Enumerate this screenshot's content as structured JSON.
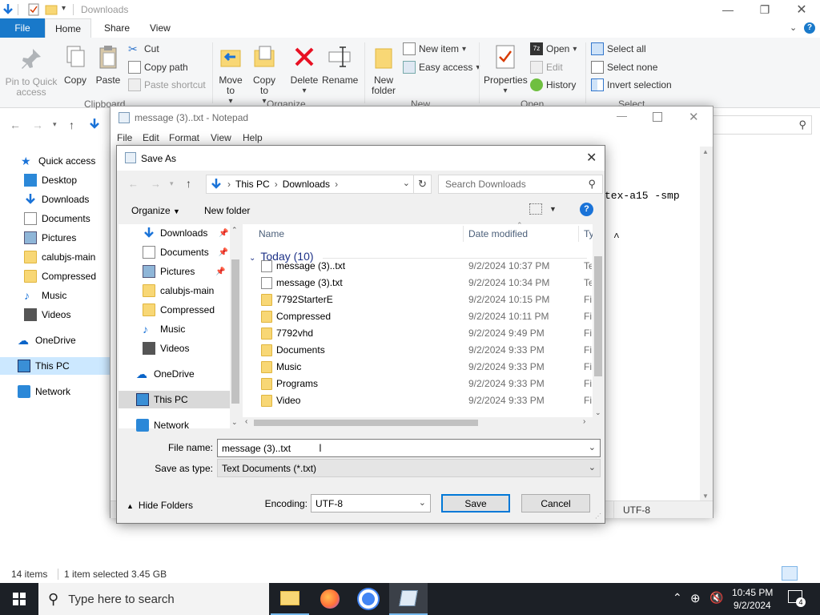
{
  "explorer": {
    "title": "Downloads",
    "tabs": [
      "File",
      "Home",
      "Share",
      "View"
    ],
    "ribbon": {
      "pin_to_quick_access": "Pin to Quick access",
      "copy": "Copy",
      "paste": "Paste",
      "cut": "Cut",
      "copy_path": "Copy path",
      "paste_shortcut": "Paste shortcut",
      "clipboard_group": "Clipboard",
      "move_to": "Move to",
      "copy_to": "Copy to",
      "delete": "Delete",
      "rename": "Rename",
      "organize_group": "Organize",
      "new_folder": "New folder",
      "new_item": "New item",
      "easy_access": "Easy access",
      "new_group": "New",
      "properties": "Properties",
      "open": "Open",
      "edit": "Edit",
      "history": "History",
      "open_group": "Open",
      "select_all": "Select all",
      "select_none": "Select none",
      "invert_selection": "Invert selection",
      "select_group": "Select"
    },
    "nav": {
      "quick_access": "Quick access",
      "desktop": "Desktop",
      "downloads": "Downloads",
      "documents": "Documents",
      "pictures": "Pictures",
      "calubjs_main": "calubjs-main",
      "compressed": "Compressed",
      "music": "Music",
      "videos": "Videos",
      "onedrive": "OneDrive",
      "this_pc": "This PC",
      "network": "Network"
    },
    "status": {
      "items": "14 items",
      "selected": "1 item selected  3.45 GB"
    }
  },
  "notepad": {
    "title": "message (3)..txt - Notepad",
    "menu": [
      "File",
      "Edit",
      "Format",
      "View",
      "Help"
    ],
    "text_line1": "tex-a15 -smp",
    "text_line2": "^",
    "status_encoding": "UTF-8"
  },
  "saveas": {
    "title": "Save As",
    "path": {
      "this_pc": "This PC",
      "downloads": "Downloads"
    },
    "search_placeholder": "Search Downloads",
    "organize": "Organize",
    "new_folder": "New folder",
    "nav": {
      "downloads": "Downloads",
      "documents": "Documents",
      "pictures": "Pictures",
      "calubjs_main": "calubjs-main",
      "compressed": "Compressed",
      "music": "Music",
      "videos": "Videos",
      "onedrive": "OneDrive",
      "this_pc": "This PC",
      "network": "Network"
    },
    "columns": {
      "name": "Name",
      "date": "Date modified",
      "type": "Ty"
    },
    "group_label": "Today (10)",
    "files": [
      {
        "name": "message (3)..txt",
        "date": "9/2/2024 10:37 PM",
        "type": "Te",
        "kind": "txt"
      },
      {
        "name": "message (3).txt",
        "date": "9/2/2024 10:34 PM",
        "type": "Te",
        "kind": "txt"
      },
      {
        "name": "7792StarterE",
        "date": "9/2/2024 10:15 PM",
        "type": "Fi",
        "kind": "folder"
      },
      {
        "name": "Compressed",
        "date": "9/2/2024 10:11 PM",
        "type": "Fi",
        "kind": "folder"
      },
      {
        "name": "7792vhd",
        "date": "9/2/2024 9:49 PM",
        "type": "Fi",
        "kind": "folder"
      },
      {
        "name": "Documents",
        "date": "9/2/2024 9:33 PM",
        "type": "Fi",
        "kind": "folder"
      },
      {
        "name": "Music",
        "date": "9/2/2024 9:33 PM",
        "type": "Fi",
        "kind": "folder"
      },
      {
        "name": "Programs",
        "date": "9/2/2024 9:33 PM",
        "type": "Fi",
        "kind": "folder"
      },
      {
        "name": "Video",
        "date": "9/2/2024 9:33 PM",
        "type": "Fi",
        "kind": "folder"
      }
    ],
    "file_name_label": "File name:",
    "file_name_value": "message (3)..txt",
    "save_type_label": "Save as type:",
    "save_type_value": "Text Documents (*.txt)",
    "hide_folders": "Hide Folders",
    "encoding_label": "Encoding:",
    "encoding_value": "UTF-8",
    "save_button": "Save",
    "cancel_button": "Cancel"
  },
  "taskbar": {
    "search_placeholder": "Type here to search",
    "time": "10:45 PM",
    "date": "9/2/2024",
    "notification_count": "4"
  },
  "colors": {
    "accent": "#0078d7",
    "file_tab": "#1979ca",
    "taskbar": "#1c2026",
    "folder": "#f8d775"
  }
}
